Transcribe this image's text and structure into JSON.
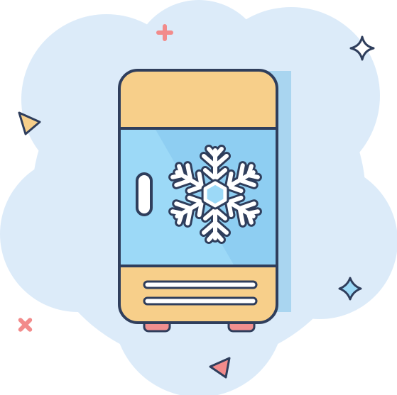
{
  "illustration": {
    "subject": "refrigerator-icon",
    "style": "flat cartoon icon with comic splash background"
  },
  "colors": {
    "background": "#ffffff",
    "splash": "#dcebf9",
    "outline": "#2f3e5c",
    "fridge_body": "#f7cf8a",
    "door_panel": "#9cd9f7",
    "door_shadow": "#7fc2ea",
    "snowflake": "#ffffff",
    "handle": "#ffffff",
    "feet": "#f08f8f",
    "plus_sign": "#f28b8b",
    "triangle_left": "#f7cf8a",
    "triangle_bottom": "#f28b8b",
    "cross_sign": "#f28b8b",
    "sparkle_top_right": "#ffffff",
    "sparkle_right": "#9cd9f7"
  },
  "decorations": [
    "plus-icon",
    "sparkle-icon",
    "triangle-icon",
    "triangle-icon",
    "cross-icon",
    "sparkle-icon"
  ]
}
